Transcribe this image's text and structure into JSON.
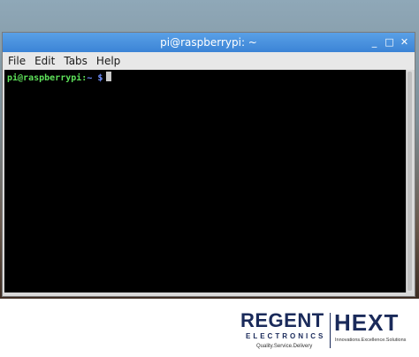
{
  "window": {
    "title": "pi@raspberrypi: ~",
    "controls": {
      "minimize": "_",
      "maximize": "□",
      "close": "✕"
    }
  },
  "menu": {
    "items": [
      "File",
      "Edit",
      "Tabs",
      "Help"
    ]
  },
  "terminal": {
    "prompt_user_host": "pi@raspberrypi",
    "prompt_sep": ":",
    "prompt_path": "~",
    "prompt_symbol": "$"
  },
  "branding": {
    "company": "REGENT",
    "division": "ELECTRONICS",
    "tagline": "Quality.Service.Delivery",
    "brand2": "HEXT",
    "tagline2": "Innovations.Excellence.Solutions"
  },
  "colors": {
    "titlebar": "#3b84d6",
    "terminal_bg": "#000000",
    "prompt_user": "#5ee35a",
    "prompt_path": "#6f8fff",
    "logo": "#1a2a5a"
  }
}
